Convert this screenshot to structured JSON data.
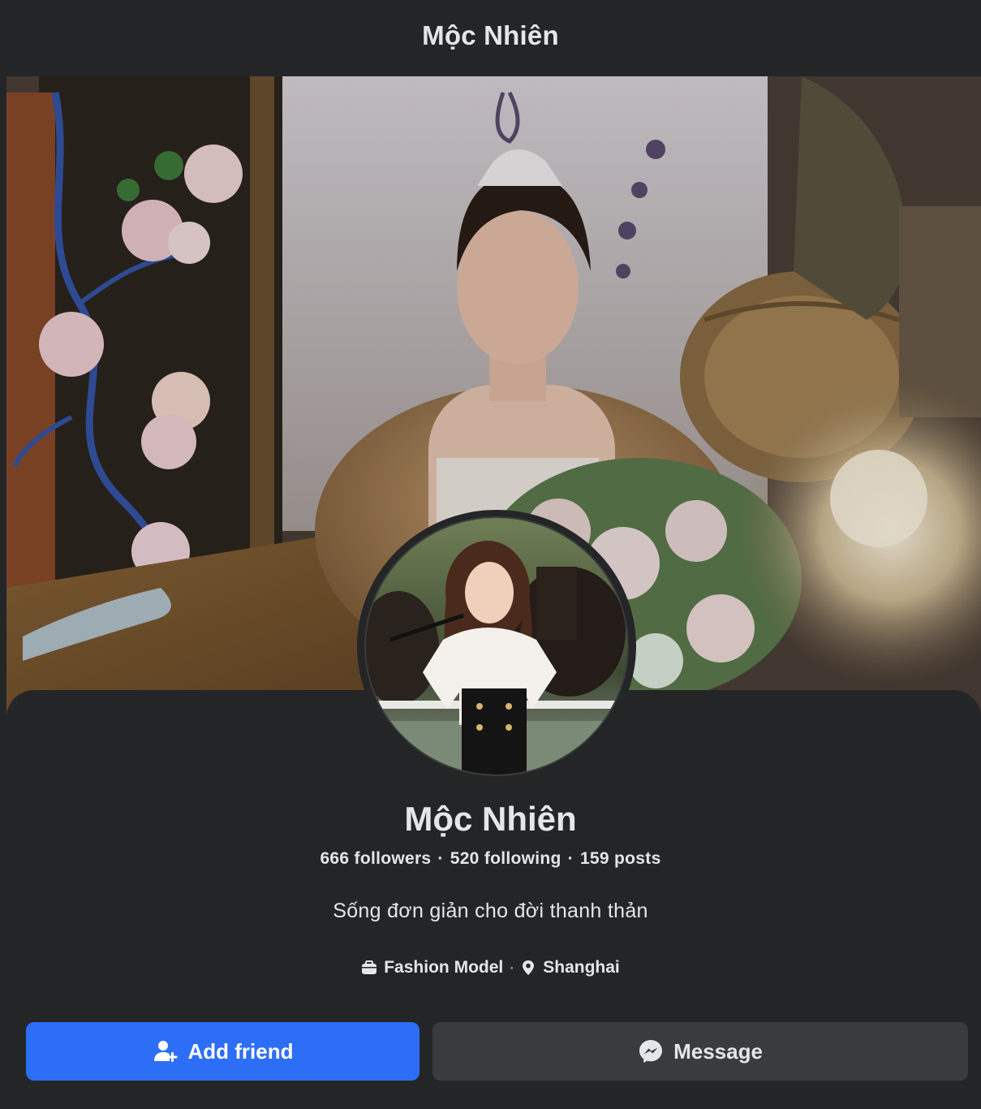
{
  "header": {
    "title": "Mộc Nhiên"
  },
  "profile": {
    "name": "Mộc Nhiên",
    "stats": {
      "followers_count": "666",
      "followers_label": "followers",
      "following_count": "520",
      "following_label": "following",
      "posts_count": "159",
      "posts_label": "posts",
      "separator": "·"
    },
    "bio": "Sống đơn giản cho đời thanh thản",
    "details": {
      "occupation": "Fashion Model",
      "occupation_icon": "briefcase-icon",
      "location": "Shanghai",
      "location_icon": "location-pin-icon",
      "separator": "·"
    }
  },
  "actions": {
    "add_friend_label": "Add friend",
    "add_friend_icon": "add-person-icon",
    "message_label": "Message",
    "message_icon": "messenger-icon"
  },
  "colors": {
    "background": "#242526",
    "primary_button": "#2d6ef7",
    "secondary_button": "#3a3b3c",
    "text": "#e4e6eb"
  }
}
